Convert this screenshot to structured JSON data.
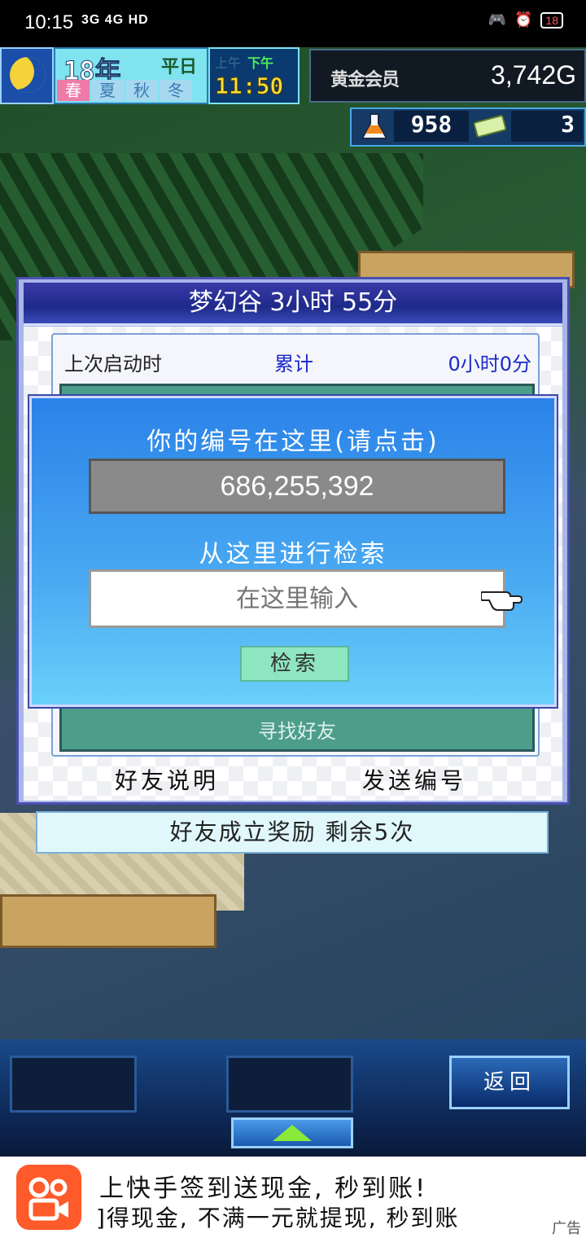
{
  "status_bar": {
    "time": "10:15",
    "network": "3G 4G HD",
    "battery": "18"
  },
  "hud": {
    "year": "18年",
    "day_type": "平日",
    "seasons": [
      "春",
      "夏",
      "秋",
      "冬"
    ],
    "active_season": "春",
    "am": "上午",
    "pm": "下午",
    "clock": "11:50",
    "gold_label": "黄金会员",
    "gold": "3,742G",
    "research_points": "958",
    "tickets": "3"
  },
  "panel": {
    "title": "梦幻谷  3小时 55分",
    "last_launch_label": "上次启动时",
    "total_label": "累计",
    "total_value": "0小时0分",
    "find_friend": "寻找好友",
    "friend_help": "好友说明",
    "send_code": "发送编号"
  },
  "reward_bar": "好友成立奖励  剩余5次",
  "dialog": {
    "your_code_label": "你的编号在这里(请点击)",
    "your_code": "686,255,392",
    "search_label": "从这里进行检索",
    "search_placeholder": "在这里输入",
    "search_button": "检索"
  },
  "toolbar": {
    "back_button": "返回"
  },
  "ad": {
    "line1": "上快手签到送现金, 秒到账!",
    "line2": "]得现金, 不满一元就提现, 秒到账",
    "tag": "广告"
  },
  "colors": {
    "dialog_blue": "#2a82e8",
    "panel_title": "#1e2a8a",
    "search_button": "#8ee6c0"
  }
}
